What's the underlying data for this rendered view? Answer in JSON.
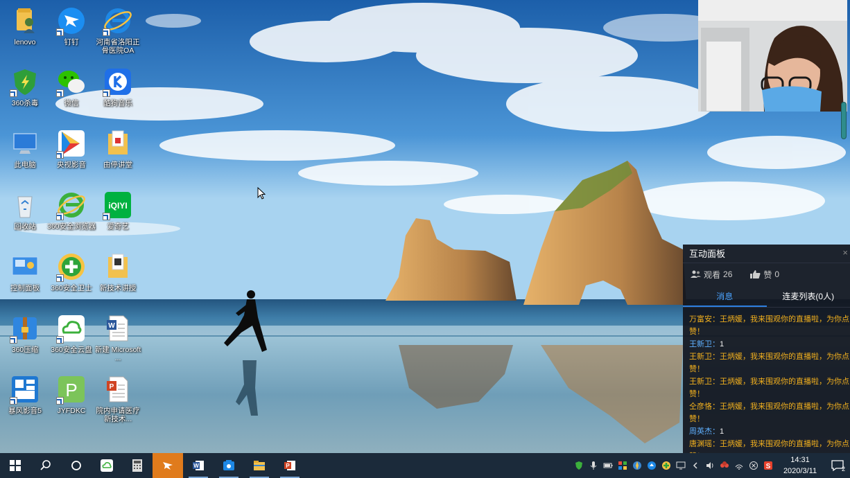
{
  "desktop_icons": [
    {
      "name": "lenovo",
      "label": "lenovo"
    },
    {
      "name": "dingtalk",
      "label": "钉钉"
    },
    {
      "name": "ie-oa",
      "label": "河南省洛阳正骨医院OA"
    },
    {
      "name": "360-antivirus",
      "label": "360杀毒"
    },
    {
      "name": "wechat",
      "label": "微信"
    },
    {
      "name": "kugou-music",
      "label": "酷狗音乐"
    },
    {
      "name": "this-pc",
      "label": "此电脑"
    },
    {
      "name": "cctv-video",
      "label": "央视影音"
    },
    {
      "name": "training-folder",
      "label": "由停讲堂"
    },
    {
      "name": "recycle-bin",
      "label": "回收站"
    },
    {
      "name": "360-browser",
      "label": "360安全浏览器"
    },
    {
      "name": "iqiyi",
      "label": "爱奇艺"
    },
    {
      "name": "control-panel",
      "label": "控制面板"
    },
    {
      "name": "360-guard",
      "label": "360安全卫士"
    },
    {
      "name": "new-tech-folder",
      "label": "新技术讲授"
    },
    {
      "name": "360-zip",
      "label": "360压缩"
    },
    {
      "name": "360-cloud",
      "label": "360安全云盘"
    },
    {
      "name": "new-word-doc",
      "label": "新建 Microsoft ..."
    },
    {
      "name": "storm-player",
      "label": "暴风影音5"
    },
    {
      "name": "jyfdkc",
      "label": "JYFDKC"
    },
    {
      "name": "ppt-file",
      "label": "院内申请医疗新技术..."
    }
  ],
  "panel": {
    "title": "互动面板",
    "close": "×",
    "viewers_label": "观看",
    "viewers_count": "26",
    "likes_label": "赞",
    "likes_count": "0",
    "tab_messages": "消息",
    "tab_mic_list": "连麦列表(0人)",
    "messages": [
      {
        "sender": "万富安：",
        "text": "王炳媛，我来围观你的直播啦，为你点赞！",
        "style": "warm"
      },
      {
        "sender": "王新卫：",
        "text": "1",
        "style": "cool"
      },
      {
        "sender": "王新卫：",
        "text": "王炳媛，我来围观你的直播啦，为你点赞！",
        "style": "warm"
      },
      {
        "sender": "王新卫：",
        "text": "王炳媛，我来围观你的直播啦，为你点赞！",
        "style": "warm"
      },
      {
        "sender": "仝彦恪：",
        "text": "王炳媛，我来围观你的直播啦，为你点赞！",
        "style": "warm"
      },
      {
        "sender": "周英杰：",
        "text": "1",
        "style": "cool"
      },
      {
        "sender": "唐渊瑶：",
        "text": "王炳媛，我来围观你的直播啦，为你点赞！",
        "style": "warm"
      }
    ]
  },
  "taskbar": {
    "buttons": [
      "windows-start",
      "search",
      "cortana",
      "360-cloud",
      "calculator",
      "dingtalk",
      "word",
      "camera-app",
      "file-explorer",
      "powerpoint"
    ],
    "time": "14:31",
    "date": "2020/3/11",
    "notification_count": "2"
  },
  "colors": {
    "panel_bg": "#12161e",
    "warm_text": "#f2b01e",
    "cool_text": "#5fb0ff",
    "tab_active": "#4aa3ff",
    "taskbar_bg": "#1b2a3a",
    "taskbar_active": "#e07b1c"
  }
}
